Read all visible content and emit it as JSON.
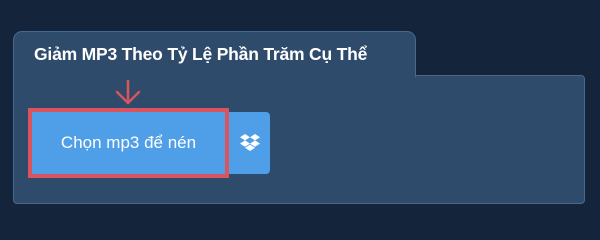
{
  "panel": {
    "title": "Giảm MP3 Theo Tỷ Lệ Phần Trăm Cụ Thể"
  },
  "upload": {
    "choose_label": "Chọn mp3 để nén",
    "dropbox_icon": "dropbox-icon"
  },
  "colors": {
    "background": "#13243b",
    "panel": "#2f4b6c",
    "button": "#4f9ee8",
    "highlight": "#d9545d"
  }
}
